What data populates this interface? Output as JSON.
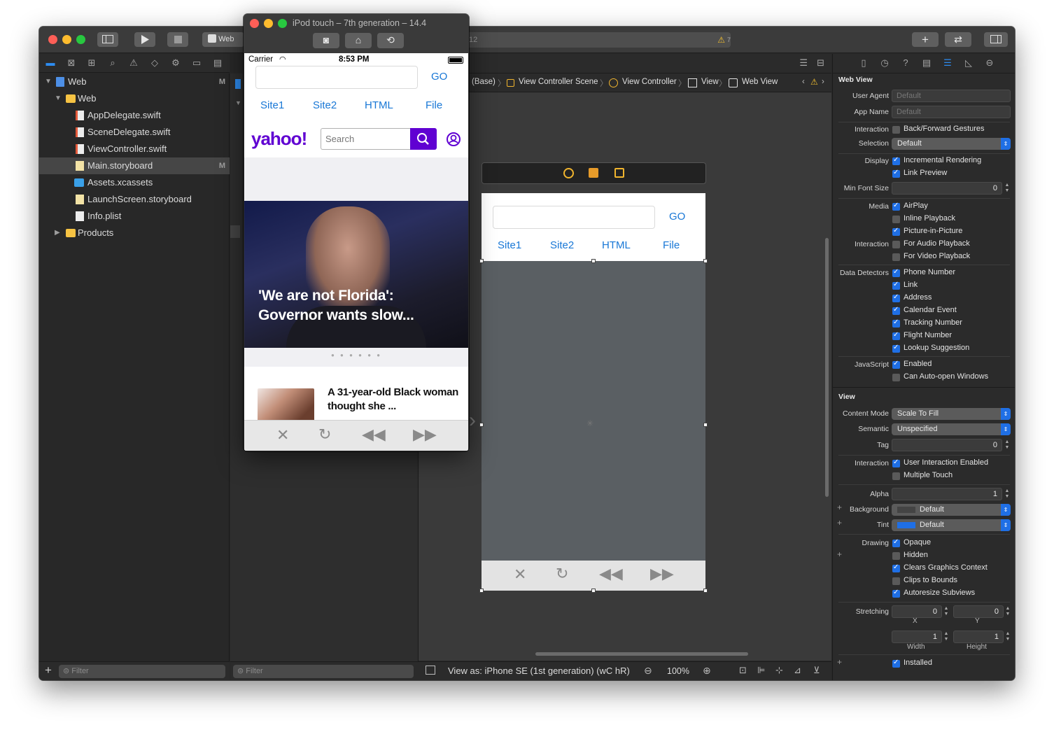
{
  "xcode": {
    "toolbar": {
      "scheme_label": "Web",
      "status_text": "12",
      "warning_count": "7",
      "add_label": "+",
      "swap_label": "⇄"
    },
    "navigator": {
      "items": [
        {
          "label": "Web",
          "badge": "M"
        },
        {
          "label": "Web",
          "badge": ""
        },
        {
          "label": "AppDelegate.swift",
          "badge": ""
        },
        {
          "label": "SceneDelegate.swift",
          "badge": ""
        },
        {
          "label": "ViewController.swift",
          "badge": ""
        },
        {
          "label": "Main.storyboard",
          "badge": "M"
        },
        {
          "label": "Assets.xcassets",
          "badge": ""
        },
        {
          "label": "LaunchScreen.storyboard",
          "badge": ""
        },
        {
          "label": "Info.plist",
          "badge": ""
        },
        {
          "label": "Products",
          "badge": ""
        }
      ],
      "filter_placeholder": "Filter"
    },
    "outline": {
      "filter_placeholder": "Filter"
    },
    "jumpbar": {
      "crumbs": [
        "(Base)",
        "View Controller Scene",
        "View Controller",
        "View",
        "Web View"
      ]
    },
    "canvas": {
      "view_as": "View as: iPhone SE (1st generation) (",
      "size_class": "wC hR)",
      "zoom": "100%"
    },
    "storyboard": {
      "go_label": "GO",
      "links": [
        "Site1",
        "Site2",
        "HTML",
        "File"
      ]
    },
    "inspector": {
      "section_webview": "Web View",
      "user_agent_label": "User Agent",
      "user_agent_ph": "Default",
      "app_name_label": "App Name",
      "app_name_ph": "Default",
      "interaction_label": "Interaction",
      "back_forward": "Back/Forward Gestures",
      "selection_label": "Selection",
      "selection_value": "Default",
      "display_label": "Display",
      "incremental": "Incremental Rendering",
      "link_preview": "Link Preview",
      "min_font_label": "Min Font Size",
      "min_font_value": "0",
      "media_label": "Media",
      "airplay": "AirPlay",
      "inline_playback": "Inline Playback",
      "pip": "Picture-in-Picture",
      "interaction2_label": "Interaction",
      "audio_playback": "For Audio Playback",
      "video_playback": "For Video Playback",
      "data_detectors_label": "Data Detectors",
      "detectors": [
        "Phone Number",
        "Link",
        "Address",
        "Calendar Event",
        "Tracking Number",
        "Flight Number",
        "Lookup Suggestion"
      ],
      "javascript_label": "JavaScript",
      "js_enabled": "Enabled",
      "js_auto_open": "Can Auto-open Windows",
      "section_view": "View",
      "content_mode_label": "Content Mode",
      "content_mode_value": "Scale To Fill",
      "semantic_label": "Semantic",
      "semantic_value": "Unspecified",
      "tag_label": "Tag",
      "tag_value": "0",
      "interaction3_label": "Interaction",
      "user_interaction": "User Interaction Enabled",
      "multiple_touch": "Multiple Touch",
      "alpha_label": "Alpha",
      "alpha_value": "1",
      "background_label": "Background",
      "background_value": "Default",
      "tint_label": "Tint",
      "tint_value": "Default",
      "tint_color": "#1f6fe5",
      "drawing_label": "Drawing",
      "drawing": [
        "Opaque",
        "Hidden",
        "Clears Graphics Context",
        "Clips to Bounds",
        "Autoresize Subviews"
      ],
      "stretching_label": "Stretching",
      "stretch_x": "0",
      "stretch_y": "0",
      "x_label": "X",
      "y_label": "Y",
      "stretch_w": "1",
      "stretch_h": "1",
      "width_label": "Width",
      "height_label": "Height",
      "installed": "Installed"
    }
  },
  "simulator": {
    "title": "iPod touch – 7th generation – 14.4",
    "status": {
      "carrier": "Carrier",
      "time": "8:53 PM"
    },
    "go_label": "GO",
    "links": [
      "Site1",
      "Site2",
      "HTML",
      "File"
    ],
    "yahoo_logo": "yahoo!",
    "search_placeholder": "Search",
    "hero_headline": "'We are not Florida': Governor wants slow...",
    "story_headline": "A 31-year-old Black woman thought she ..."
  },
  "colors": {
    "accent": "#1f6fe5",
    "yahoo_purple": "#6001d2",
    "link_blue": "#1877d6"
  }
}
